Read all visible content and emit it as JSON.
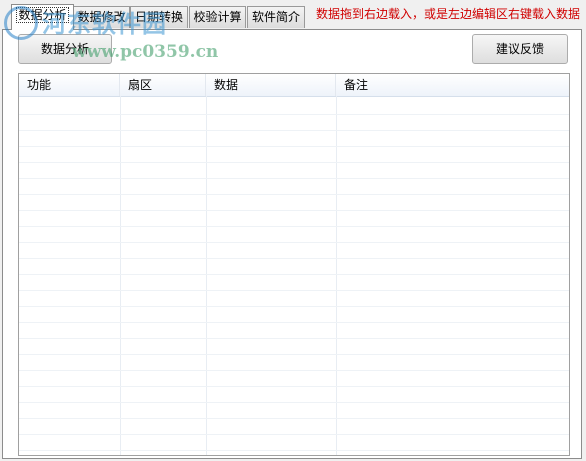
{
  "tabs": [
    {
      "label": "数据分析",
      "active": true
    },
    {
      "label": "数据修改",
      "active": false
    },
    {
      "label": "日期转换",
      "active": false
    },
    {
      "label": "校验计算",
      "active": false
    },
    {
      "label": "软件简介",
      "active": false
    }
  ],
  "notice": "数据拖到右边载入，或是左边编辑区右键载入数据",
  "buttons": {
    "analyze": "数据分析",
    "feedback": "建议反馈"
  },
  "table": {
    "columns": [
      "功能",
      "扇区",
      "数据",
      "备注"
    ],
    "rows": []
  },
  "watermark": {
    "title": "河东软件园",
    "url": "www.pc0359.cn"
  },
  "colors": {
    "notice": "#d00000",
    "header_bg": "#eef3fa"
  }
}
